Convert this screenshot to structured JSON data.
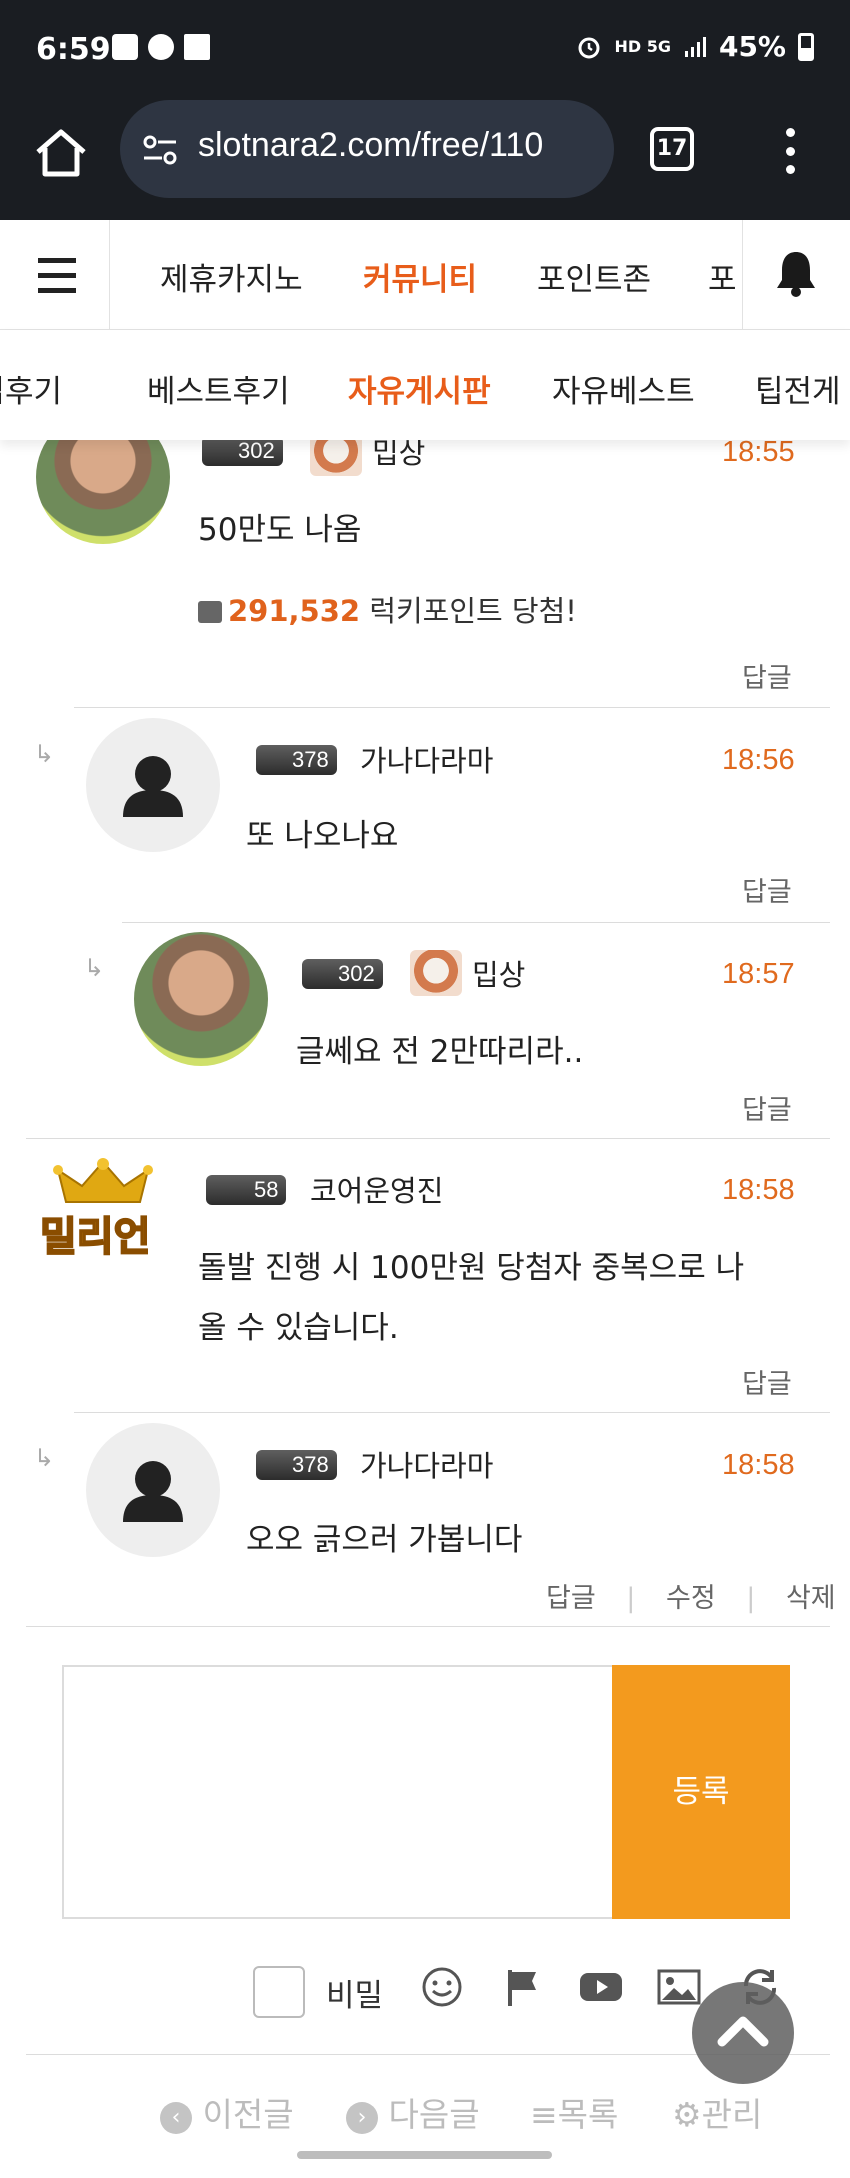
{
  "status_bar": {
    "time": "6:59",
    "network": "HD 5G",
    "battery": "45%"
  },
  "browser": {
    "url": "slotnara2.com/free/110",
    "tab_count": "17"
  },
  "site_nav": {
    "items": [
      {
        "label": "제휴카지노",
        "active": false
      },
      {
        "label": "커뮤니티",
        "active": true
      },
      {
        "label": "포인트존",
        "active": false
      }
    ],
    "partial_next": "포"
  },
  "sub_nav": {
    "items": [
      {
        "label": "가입후기",
        "active": false
      },
      {
        "label": "베스트후기",
        "active": false
      },
      {
        "label": "자유게시판",
        "active": true
      },
      {
        "label": "자유베스트",
        "active": false
      },
      {
        "label": "팁전게",
        "active": false
      }
    ]
  },
  "comments": [
    {
      "level": "302",
      "nick": "밉상",
      "time": "18:55",
      "body": "50만도 나옴",
      "points": "291,532",
      "points_suffix": "럭키포인트 당첨!",
      "reply": "답글"
    },
    {
      "level": "378",
      "nick": "가나다라마",
      "time": "18:56",
      "body": "또 나오나요",
      "reply": "답글"
    },
    {
      "level": "302",
      "nick": "밉상",
      "time": "18:57",
      "body": "글쎄요 전 2만따리라..",
      "reply": "답글"
    },
    {
      "level": "58",
      "nick": "코어운영진",
      "time": "18:58",
      "body": "돌발 진행 시 100만원 당첨자 중복으로 나\n올 수 있습니다.",
      "reply": "답글",
      "avatar_text": "밀리언"
    },
    {
      "level": "378",
      "nick": "가나다라마",
      "time": "18:58",
      "body": "오오 긁으러 가봅니다",
      "reply": "답글",
      "edit": "수정",
      "delete": "삭제"
    }
  ],
  "write": {
    "submit_label": "등록",
    "secret_label": "비밀"
  },
  "footer_nav": {
    "prev": "이전글",
    "next": "다음글",
    "list": "목록",
    "manage": "관리"
  },
  "colors": {
    "accent": "#e85d1a",
    "submit": "#f39a1e",
    "time": "#e06a1e"
  }
}
